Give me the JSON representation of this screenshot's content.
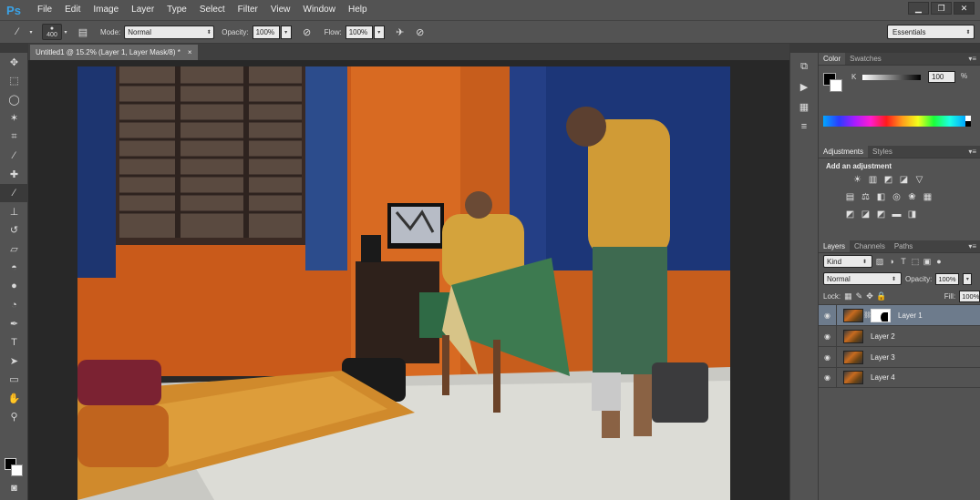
{
  "app": {
    "logo": "Ps"
  },
  "menu": [
    "File",
    "Edit",
    "Image",
    "Layer",
    "Type",
    "Select",
    "Filter",
    "View",
    "Window",
    "Help"
  ],
  "window_controls": [
    "minimize-icon",
    "restore-icon",
    "close-icon"
  ],
  "options": {
    "brush_size": "400",
    "mode_label": "Mode:",
    "mode_value": "Normal",
    "opacity_label": "Opacity:",
    "opacity_value": "100%",
    "flow_label": "Flow:",
    "flow_value": "100%"
  },
  "workspace": "Essentials",
  "document_tab": {
    "title": "Untitled1 @ 15.2% (Layer 1, Layer Mask/8) *",
    "close": "×"
  },
  "color_panel": {
    "tabs": [
      "Color",
      "Swatches"
    ],
    "channel": "K",
    "value": "100",
    "unit": "%"
  },
  "adjustments_panel": {
    "tabs": [
      "Adjustments",
      "Styles"
    ],
    "title": "Add an adjustment"
  },
  "layers_panel": {
    "tabs": [
      "Layers",
      "Channels",
      "Paths"
    ],
    "kind": "Kind",
    "blend_mode": "Normal",
    "opacity_label": "Opacity:",
    "opacity_value": "100%",
    "lock_label": "Lock:",
    "fill_label": "Fill:",
    "fill_value": "100%",
    "layers": [
      {
        "name": "Layer 1",
        "selected": true,
        "has_mask": true
      },
      {
        "name": "Layer 2",
        "selected": false,
        "has_mask": false
      },
      {
        "name": "Layer 3",
        "selected": false,
        "has_mask": false
      },
      {
        "name": "Layer 4",
        "selected": false,
        "has_mask": false
      }
    ]
  },
  "colors": {
    "foreground": "#000000",
    "background": "#ffffff",
    "selection": "#6d7b8c",
    "accent": "#3aa3e8"
  }
}
